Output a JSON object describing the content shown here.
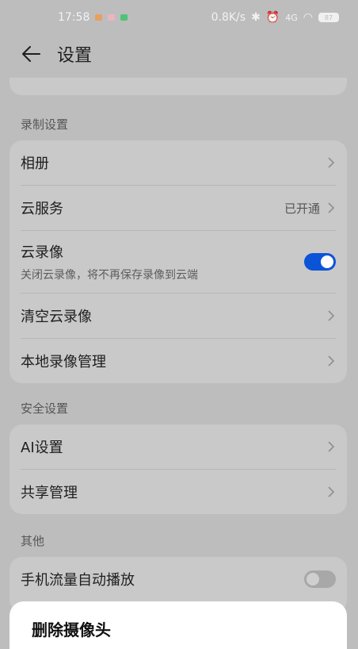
{
  "status": {
    "time": "17:58",
    "speed": "0.8K/s",
    "network": "4G",
    "battery": "87"
  },
  "header": {
    "title": "设置",
    "back_icon": "arrow-left-icon"
  },
  "sections": {
    "recording": {
      "title": "录制设置",
      "items": [
        {
          "label": "相册"
        },
        {
          "label": "云服务",
          "value": "已开通"
        },
        {
          "label": "云录像",
          "subtitle": "关闭云录像，将不再保存录像到云端",
          "toggle": true
        },
        {
          "label": "清空云录像"
        },
        {
          "label": "本地录像管理"
        }
      ]
    },
    "security": {
      "title": "安全设置",
      "items": [
        {
          "label": "AI设置"
        },
        {
          "label": "共享管理"
        }
      ]
    },
    "other": {
      "title": "其他",
      "items": [
        {
          "label": "手机流量自动播放",
          "toggle": false
        }
      ]
    }
  },
  "sheet": {
    "label": "删除摄像头"
  },
  "colors": {
    "accent": "#0b54d8",
    "toggle_off": "#a8a8a8",
    "background": "#bdbdbd",
    "card": "#c9c9c9"
  }
}
